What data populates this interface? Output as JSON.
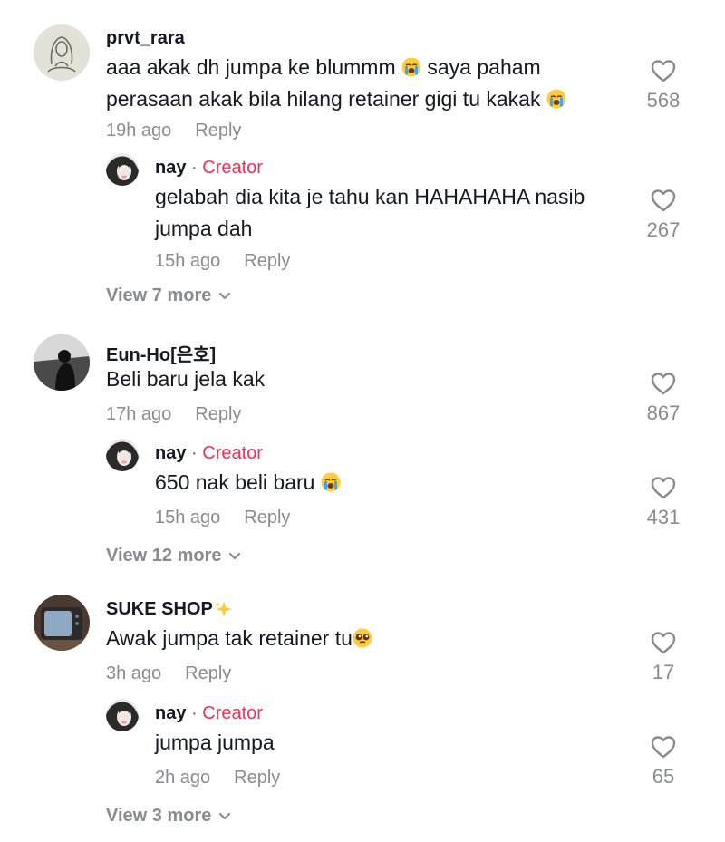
{
  "threads": [
    {
      "comment": {
        "username": "prvt_rara",
        "text_line1": "aaa akak dh jumpa ke blummm",
        "text_line1b": "saya paham",
        "text_line2": "perasaan akak bila hilang retainer gigi tu kakak",
        "time": "19h ago",
        "reply_label": "Reply",
        "likes": "568"
      },
      "reply": {
        "username": "nay",
        "separator": "·",
        "badge": "Creator",
        "text": "gelabah dia kita je tahu kan HAHAHAHA nasib jumpa dah",
        "time": "15h ago",
        "reply_label": "Reply",
        "likes": "267"
      },
      "view_more": "View 7 more"
    },
    {
      "comment": {
        "username": "Eun-Ho[은호]",
        "text": "Beli baru jela kak",
        "time": "17h ago",
        "reply_label": "Reply",
        "likes": "867"
      },
      "reply": {
        "username": "nay",
        "separator": "·",
        "badge": "Creator",
        "text": "650 nak beli baru",
        "time": "15h ago",
        "reply_label": "Reply",
        "likes": "431"
      },
      "view_more": "View 12 more"
    },
    {
      "comment": {
        "username": "SUKE SHOP",
        "text": "Awak jumpa tak retainer tu",
        "time": "3h ago",
        "reply_label": "Reply",
        "likes": "17"
      },
      "reply": {
        "username": "nay",
        "separator": "·",
        "badge": "Creator",
        "text": "jumpa jumpa",
        "time": "2h ago",
        "reply_label": "Reply",
        "likes": "65"
      },
      "view_more": "View 3 more"
    }
  ],
  "icons": {
    "like": "heart-outline-icon",
    "expand": "chevron-down-icon",
    "loudly_crying": "loudly-crying-emoji",
    "pleading": "pleading-face-emoji",
    "sparkles": "sparkles-emoji"
  },
  "colors": {
    "creator_badge": "#fe2c55",
    "secondary_text": "#8a8b91",
    "primary_text": "#161823"
  }
}
